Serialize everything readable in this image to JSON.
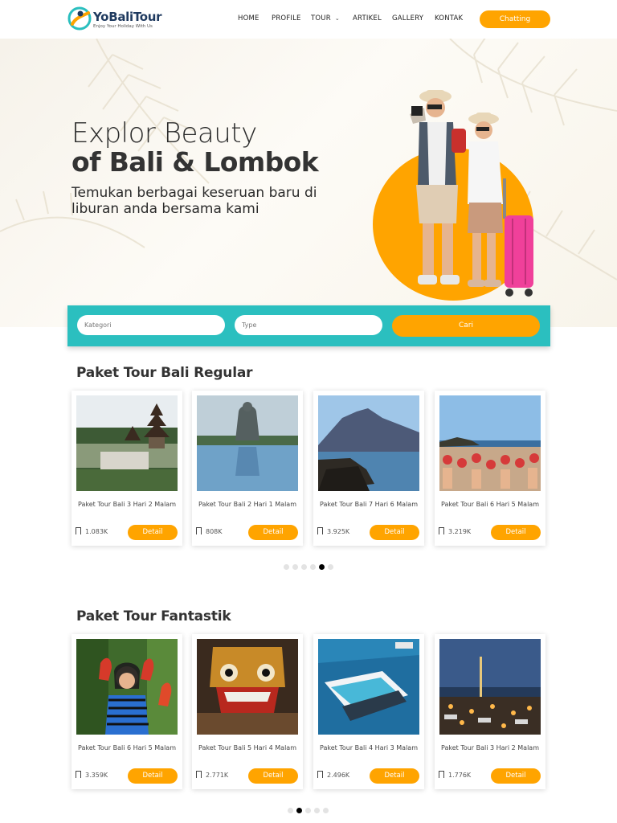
{
  "brand": {
    "name": "YoBaliTour",
    "tagline": "Enjoy Your Holiday With Us",
    "accent": "#ffa400",
    "teal": "#2bbfbf"
  },
  "nav": {
    "items": [
      "HOME",
      "PROFILE",
      "TOUR",
      "ARTIKEL",
      "GALLERY",
      "KONTAK"
    ],
    "chatting": "Chatting"
  },
  "hero": {
    "line1": "Explor Beauty",
    "line2": "of Bali & Lombok",
    "subtitle": "Temukan berbagai keseruan baru di liburan anda bersama kami"
  },
  "search": {
    "kategori_placeholder": "Kategori",
    "type_placeholder": "Type",
    "button": "Cari"
  },
  "sections": [
    {
      "title": "Paket Tour Bali Regular",
      "active_dot": 4,
      "dot_count": 6,
      "cards": [
        {
          "title": "Paket Tour Bali 3 Hari 2 Malam",
          "count": "1.083K",
          "button": "Detail",
          "image": "temple-lake"
        },
        {
          "title": "Paket Tour Bali 2 Hari 1 Malam",
          "count": "808K",
          "button": "Detail",
          "image": "gwk-statue"
        },
        {
          "title": "Paket Tour Bali 7 Hari 6 Malam",
          "count": "3.925K",
          "button": "Detail",
          "image": "mount-batur"
        },
        {
          "title": "Paket Tour Bali 6 Hari 5 Malam",
          "count": "3.219K",
          "button": "Detail",
          "image": "kecak-dance"
        }
      ]
    },
    {
      "title": "Paket Tour Fantastik",
      "active_dot": 1,
      "dot_count": 5,
      "cards": [
        {
          "title": "Paket Tour Bali 6 Hari 5 Malam",
          "count": "3.359K",
          "button": "Detail",
          "image": "parrots-girl"
        },
        {
          "title": "Paket Tour Bali 5 Hari 4 Malam",
          "count": "2.771K",
          "button": "Detail",
          "image": "barong-mask"
        },
        {
          "title": "Paket Tour Bali 4 Hari 3 Malam",
          "count": "2.496K",
          "button": "Detail",
          "image": "pontoon-boat"
        },
        {
          "title": "Paket Tour Bali 3 Hari 2 Malam",
          "count": "1.776K",
          "button": "Detail",
          "image": "jimbaran-dinner"
        }
      ]
    }
  ]
}
